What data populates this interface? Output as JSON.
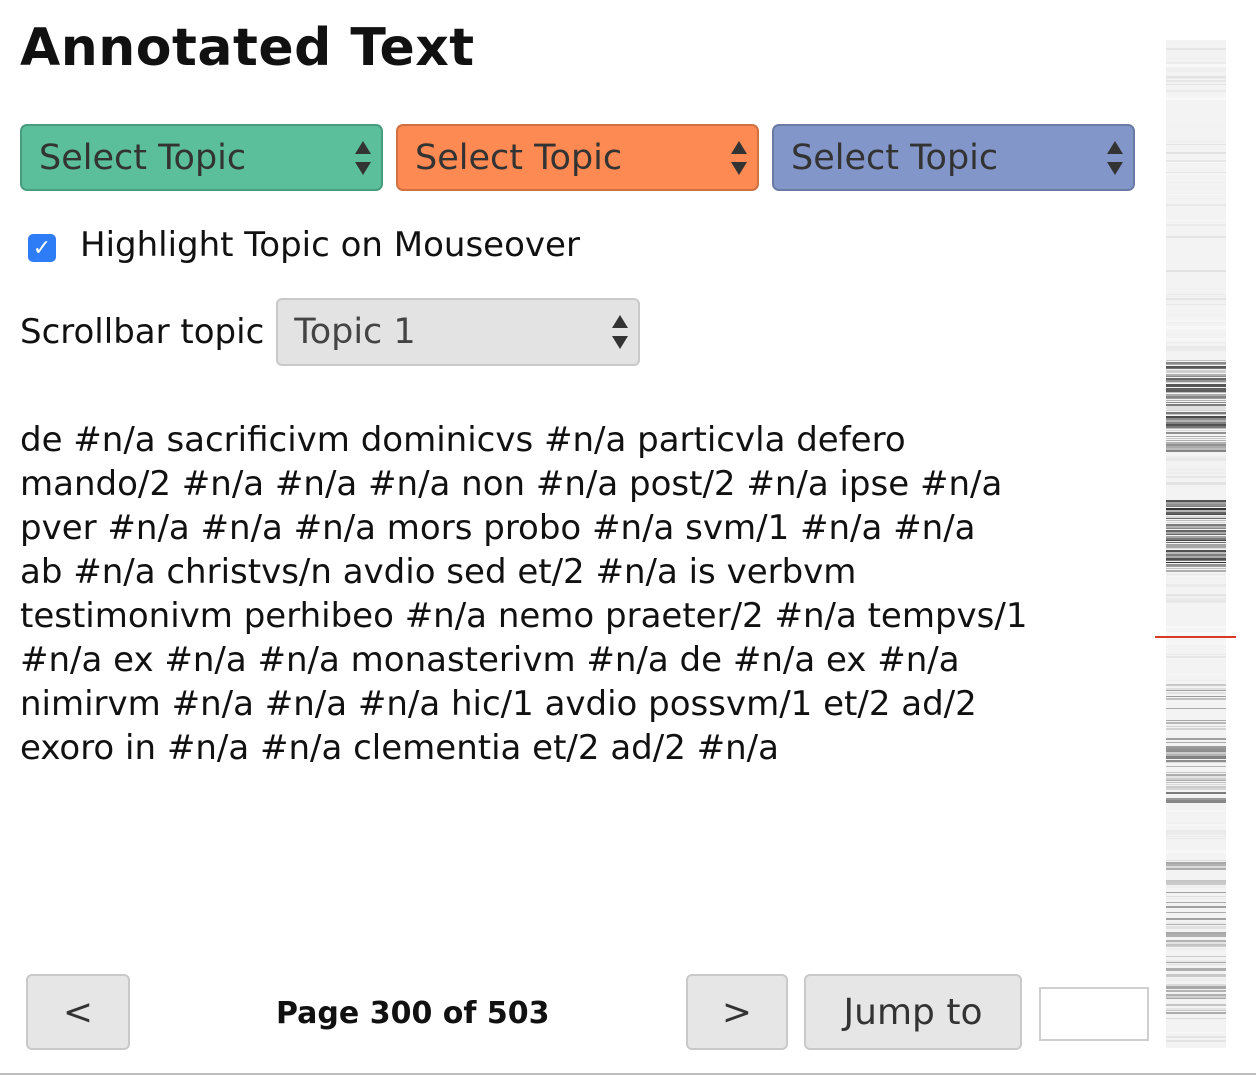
{
  "header": {
    "title": "Annotated Text"
  },
  "topic_selects": [
    {
      "label": "Select Topic",
      "color": "#5bbf9c"
    },
    {
      "label": "Select Topic",
      "color": "#fd8a52"
    },
    {
      "label": "Select Topic",
      "color": "#8396c9"
    }
  ],
  "highlight": {
    "label": "Highlight Topic on Mouseover",
    "checked": true
  },
  "scrollbar_topic": {
    "label": "Scrollbar topic",
    "value": "Topic 1"
  },
  "text_lines": [
    "de #n/a sacrificivm dominicvs #n/a particvla defero",
    "mando/2 #n/a #n/a #n/a non #n/a post/2 #n/a ipse #n/a",
    "pver #n/a #n/a #n/a mors probo #n/a svm/1 #n/a #n/a",
    "ab #n/a christvs/n avdio sed et/2 #n/a is verbvm",
    "testimonivm perhibeo #n/a nemo praeter/2 #n/a tempvs/1",
    "#n/a ex #n/a #n/a monasterivm #n/a de #n/a ex #n/a",
    "nimirvm #n/a #n/a #n/a hic/1 avdio possvm/1 et/2 ad/2",
    "exoro in #n/a #n/a clementia et/2 ad/2 #n/a"
  ],
  "pagination": {
    "prev_label": "<",
    "next_label": ">",
    "page_text": "Page 300 of 503",
    "jump_label": "Jump to",
    "jump_value": ""
  },
  "colors": {
    "checkbox": "#2f7df6",
    "scroll_indicator": "#d93a22"
  }
}
